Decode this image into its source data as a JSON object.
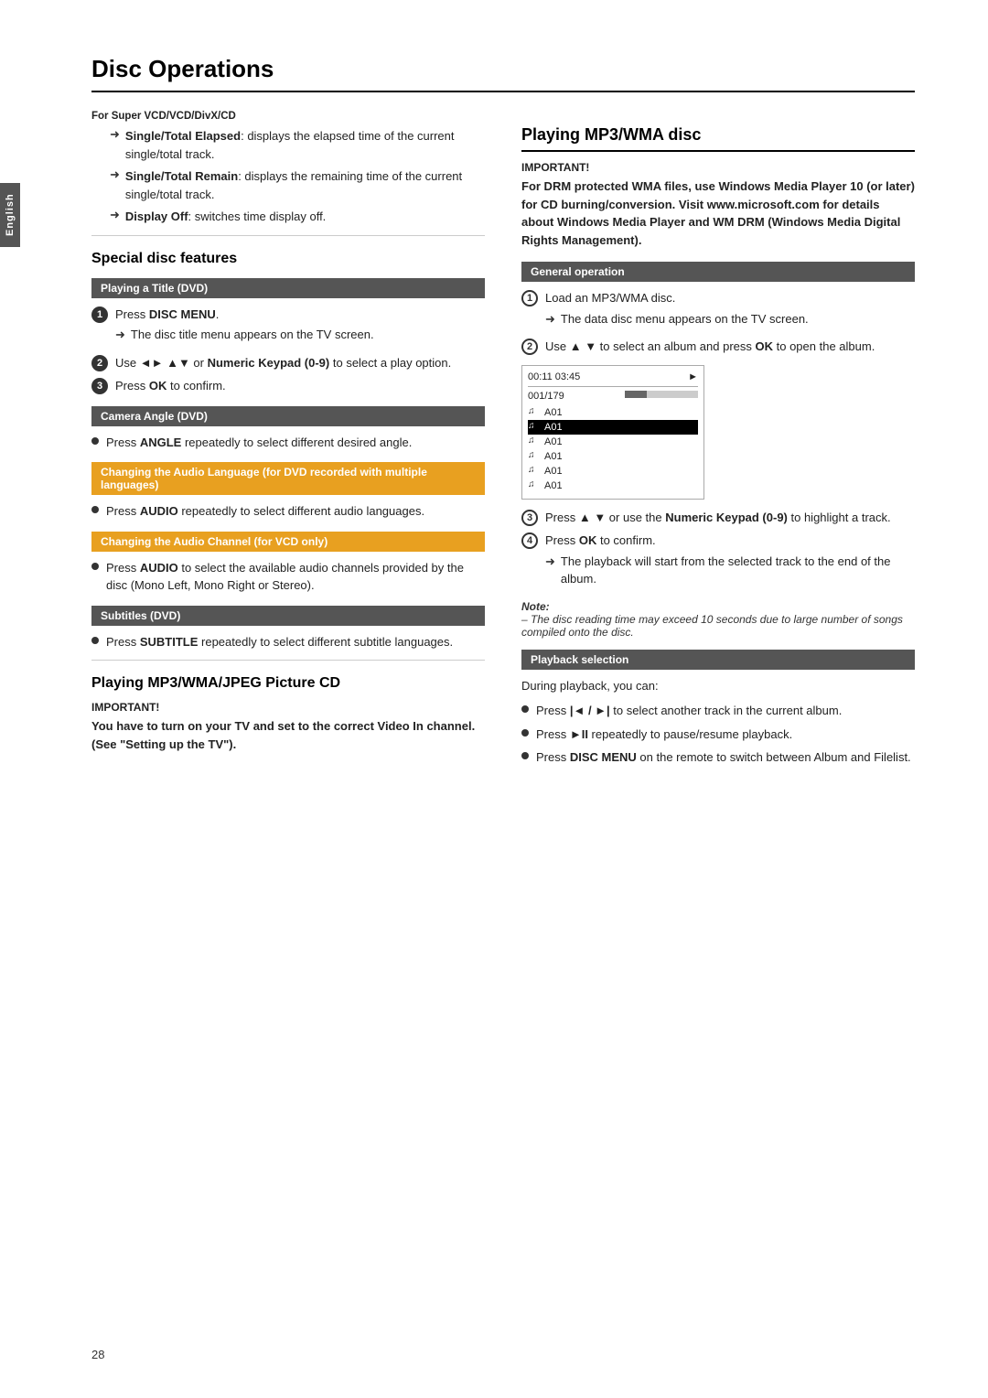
{
  "page": {
    "title": "Disc Operations",
    "number": "28",
    "lang_tab": "English"
  },
  "super_vcd": {
    "heading": "For Super VCD/VCD/DivX/CD",
    "items": [
      {
        "label": "Single/Total Elapsed",
        "text": ": displays the elapsed time of the current single/total track."
      },
      {
        "label": "Single/Total Remain",
        "text": ": displays the remaining time of the current single/total track."
      },
      {
        "label": "Display Off",
        "text": ": switches time display off."
      }
    ]
  },
  "special_disc": {
    "heading": "Special disc features",
    "playing_title": {
      "bar": "Playing a Title (DVD)",
      "steps": [
        {
          "num": "1",
          "text": "Press DISC MENU.",
          "arrow": "The disc title menu appears on the TV screen."
        },
        {
          "num": "2",
          "text": "Use ◄► ▲▼  or Numeric Keypad (0-9) to select a play option."
        },
        {
          "num": "3",
          "text": "Press OK to confirm."
        }
      ]
    },
    "camera_angle": {
      "bar": "Camera Angle (DVD)",
      "item": "Press ANGLE repeatedly to select different desired angle."
    },
    "audio_language": {
      "bar": "Changing the Audio Language (for DVD recorded with multiple languages)",
      "item": "Press AUDIO repeatedly to select different audio languages."
    },
    "audio_channel": {
      "bar": "Changing the Audio Channel  (for VCD only)",
      "item": "Press AUDIO to select the available audio channels provided by the disc (Mono Left, Mono Right or Stereo)."
    },
    "subtitles": {
      "bar": "Subtitles (DVD)",
      "item": "Press SUBTITLE repeatedly to select different subtitle languages."
    }
  },
  "playing_mp3_wma_jpeg": {
    "heading": "Playing MP3/WMA/JPEG Picture CD",
    "important_label": "IMPORTANT!",
    "important_text": "You have to turn on your TV and set to the correct Video In channel. (See \"Setting up the TV\")."
  },
  "playing_mp3_wma": {
    "heading": "Playing MP3/WMA disc",
    "important_label": "IMPORTANT!",
    "important_text": "For DRM protected WMA files, use Windows Media Player 10 (or later) for CD burning/conversion. Visit www.microsoft.com for details about Windows Media Player and WM DRM (Windows Media Digital Rights Management).",
    "general_operation": {
      "bar": "General operation",
      "steps": [
        {
          "num": "1",
          "text": "Load an MP3/WMA disc.",
          "arrow": "The data disc menu appears on the TV screen."
        },
        {
          "num": "2",
          "text": "Use ▲ ▼ to select an album and press OK to open the album."
        },
        {
          "num": "3",
          "text": "Press ▲ ▼ or use the Numeric Keypad (0-9) to highlight a track."
        },
        {
          "num": "4",
          "text": "Press OK to confirm.",
          "arrow": "The playback will start from the selected track to the end of the album."
        }
      ]
    },
    "screen": {
      "time": "00:11  03:45",
      "track": "001/179",
      "play_icon": "►",
      "list_items": [
        "A01",
        "A01",
        "A01",
        "A01",
        "A01",
        "A01"
      ]
    },
    "note": {
      "label": "Note:",
      "lines": [
        "–  The disc reading time may exceed 10 seconds due to large number of songs compiled onto the disc."
      ]
    },
    "playback_selection": {
      "bar": "Playback selection",
      "intro": "During playback, you can:",
      "items": [
        "Press |◄ / ►| to select another track in the current album.",
        "Press ►II repeatedly to pause/resume playback.",
        "Press DISC MENU on the remote to switch between Album and Filelist."
      ]
    }
  }
}
